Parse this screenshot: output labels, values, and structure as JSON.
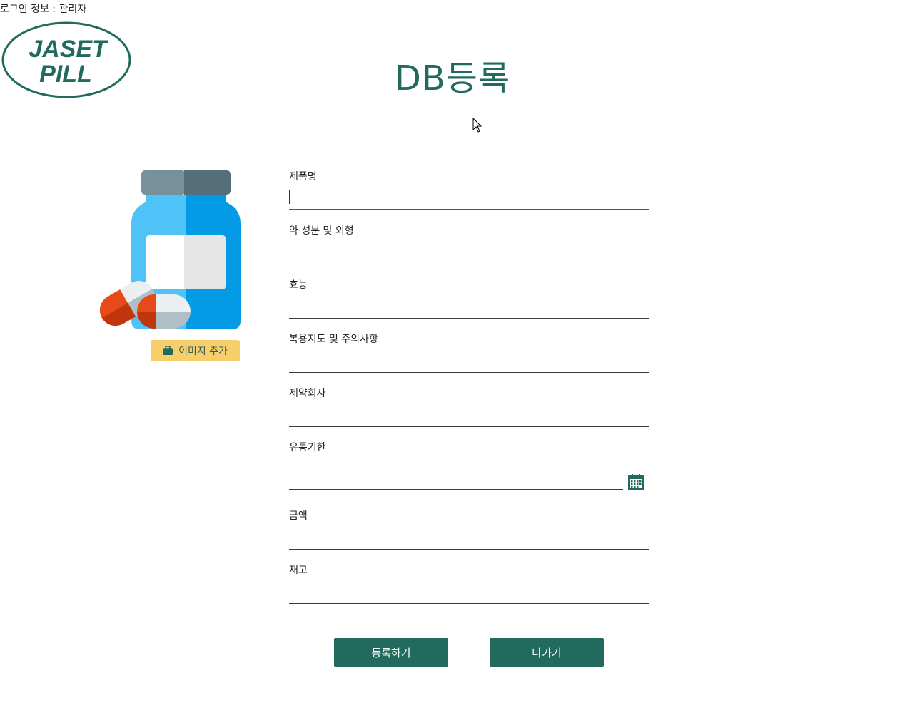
{
  "header": {
    "login_info": "로그인 정보 : 관리자",
    "logo_line1": "JASET",
    "logo_line2": "PILL",
    "page_title": "DB등록"
  },
  "image_panel": {
    "add_image_label": "이미지 추가",
    "illustration": "medicine-bottle-with-capsules",
    "add_image_icon": "briefcase-icon"
  },
  "form": {
    "fields": [
      {
        "label": "제품명",
        "value": "",
        "focused": true
      },
      {
        "label": "약 성분 및 외형",
        "value": ""
      },
      {
        "label": "효능",
        "value": ""
      },
      {
        "label": "복용지도 및 주의사항",
        "value": ""
      },
      {
        "label": "제약회사",
        "value": ""
      },
      {
        "label": "유통기한",
        "value": "",
        "icon": "calendar-icon"
      },
      {
        "label": "금액",
        "value": ""
      },
      {
        "label": "재고",
        "value": ""
      }
    ]
  },
  "actions": {
    "register_label": "등록하기",
    "exit_label": "나가기"
  },
  "colors": {
    "accent": "#216a5d",
    "add_image_bg": "#f6cf6a",
    "bottle_blue": "#4fc3f7",
    "bottle_blue_dark": "#039be5",
    "cap_gray": "#78909c",
    "capsule_red": "#e64a19"
  }
}
